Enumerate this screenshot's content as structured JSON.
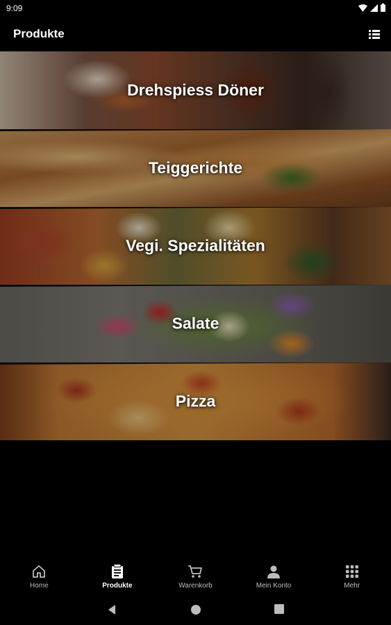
{
  "status_bar": {
    "time": "9:09"
  },
  "app_bar": {
    "title": "Produkte",
    "view_icon": "list-view-icon"
  },
  "categories": [
    {
      "label": "Drehspiess Döner",
      "image": "doner-kebab-photo"
    },
    {
      "label": "Teiggerichte",
      "image": "pide-flatbread-photo"
    },
    {
      "label": "Vegi. Spezialitäten",
      "image": "vegetable-dishes-photo"
    },
    {
      "label": "Salate",
      "image": "salad-bowl-photo"
    },
    {
      "label": "Pizza",
      "image": "pizza-photo"
    }
  ],
  "bottom_nav": {
    "items": [
      {
        "label": "Home",
        "icon": "home-icon",
        "active": false
      },
      {
        "label": "Produkte",
        "icon": "menu-card-icon",
        "active": true
      },
      {
        "label": "Warenkorb",
        "icon": "cart-icon",
        "active": false
      },
      {
        "label": "Mein Konto",
        "icon": "person-icon",
        "active": false
      },
      {
        "label": "Mehr",
        "icon": "grid-icon",
        "active": false
      }
    ]
  },
  "colors": {
    "background": "#000000",
    "text": "#ffffff",
    "inactive_nav": "#bdbdbd"
  }
}
